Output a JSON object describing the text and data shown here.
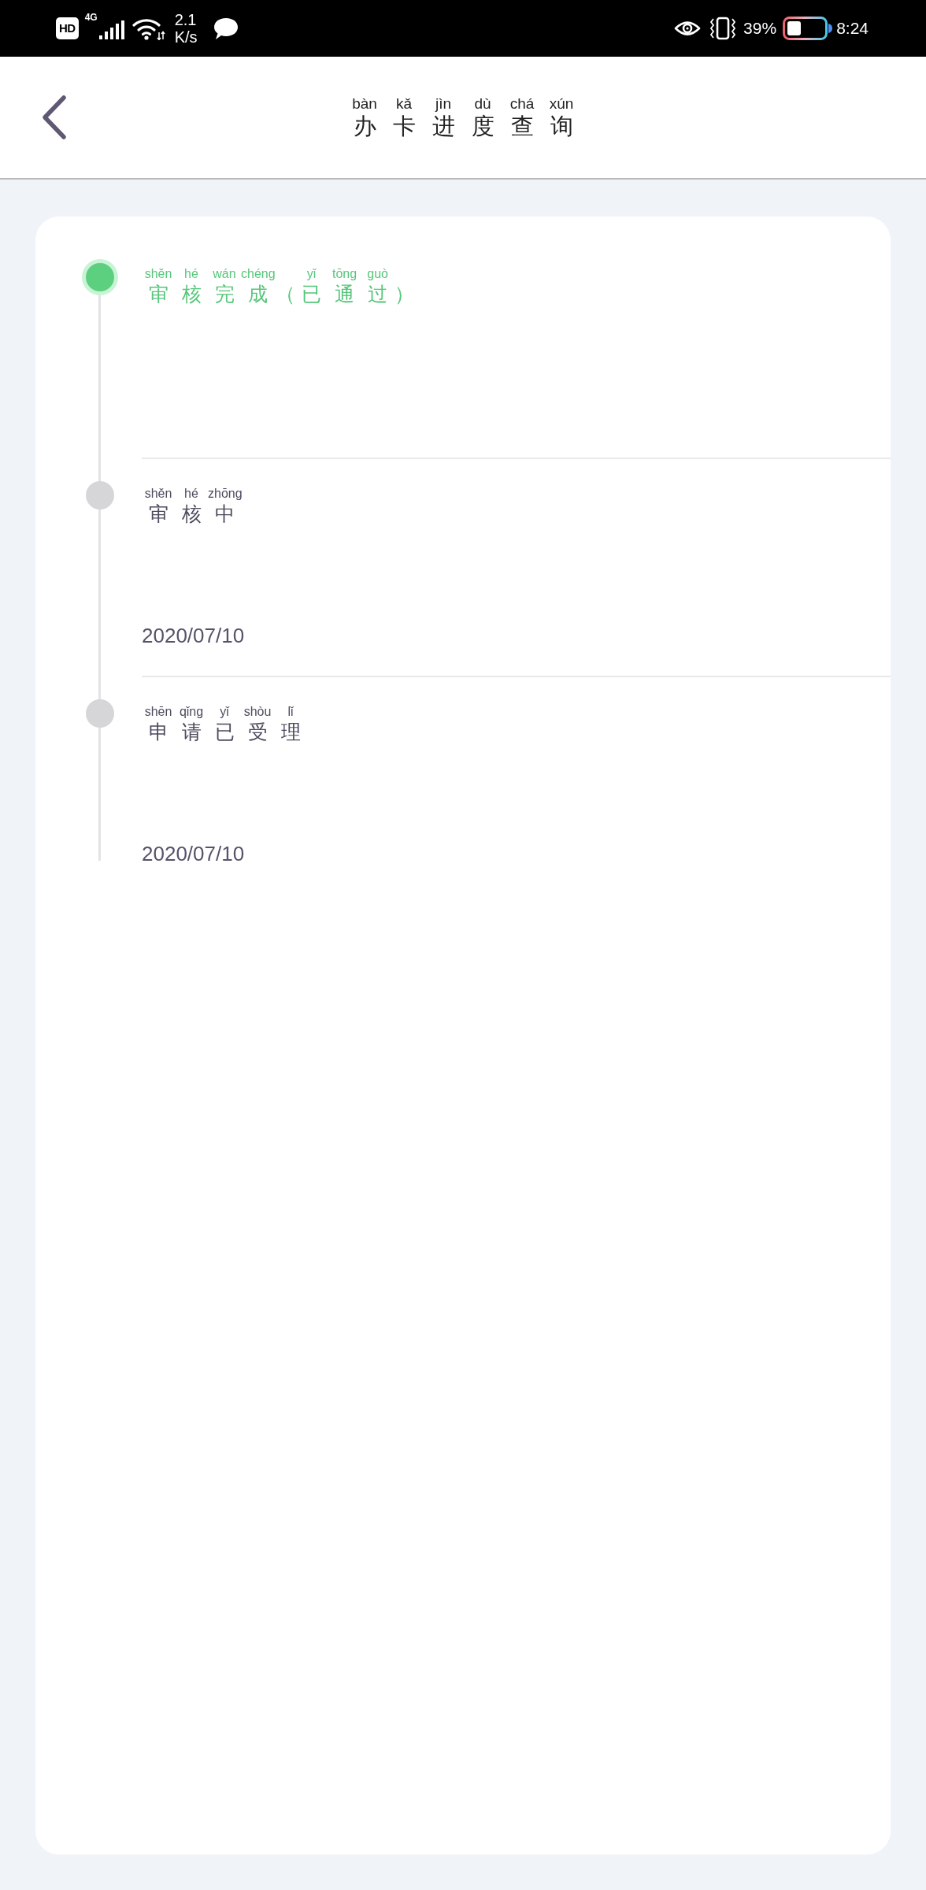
{
  "status_bar": {
    "hd_label": "HD",
    "network_type": "4G",
    "speed": "2.1",
    "speed_unit": "K/s",
    "battery_percent": "39%",
    "time": "8:24"
  },
  "header": {
    "title": [
      {
        "text": "办",
        "pinyin": "bàn"
      },
      {
        "text": "卡",
        "pinyin": "kǎ"
      },
      {
        "text": "进",
        "pinyin": "jìn"
      },
      {
        "text": "度",
        "pinyin": "dù"
      },
      {
        "text": "查",
        "pinyin": "chá"
      },
      {
        "text": "询",
        "pinyin": "xún"
      }
    ]
  },
  "steps": [
    {
      "active": true,
      "title": [
        {
          "text": "审",
          "pinyin": "shěn"
        },
        {
          "text": "核",
          "pinyin": "hé"
        },
        {
          "text": "完",
          "pinyin": "wán"
        },
        {
          "text": "成",
          "pinyin": "chéng"
        },
        {
          "text": "（"
        },
        {
          "text": "已",
          "pinyin": "yǐ"
        },
        {
          "text": "通",
          "pinyin": "tōng"
        },
        {
          "text": "过",
          "pinyin": "guò"
        },
        {
          "text": "）"
        }
      ]
    },
    {
      "active": false,
      "title": [
        {
          "text": "审",
          "pinyin": "shěn"
        },
        {
          "text": "核",
          "pinyin": "hé"
        },
        {
          "text": "中",
          "pinyin": "zhōng"
        }
      ],
      "date": "2020/07/10"
    },
    {
      "active": false,
      "title": [
        {
          "text": "申",
          "pinyin": "shēn"
        },
        {
          "text": "请",
          "pinyin": "qǐng"
        },
        {
          "text": "已",
          "pinyin": "yǐ"
        },
        {
          "text": "受",
          "pinyin": "shòu"
        },
        {
          "text": "理",
          "pinyin": "lǐ"
        }
      ],
      "date": "2020/07/10"
    }
  ]
}
